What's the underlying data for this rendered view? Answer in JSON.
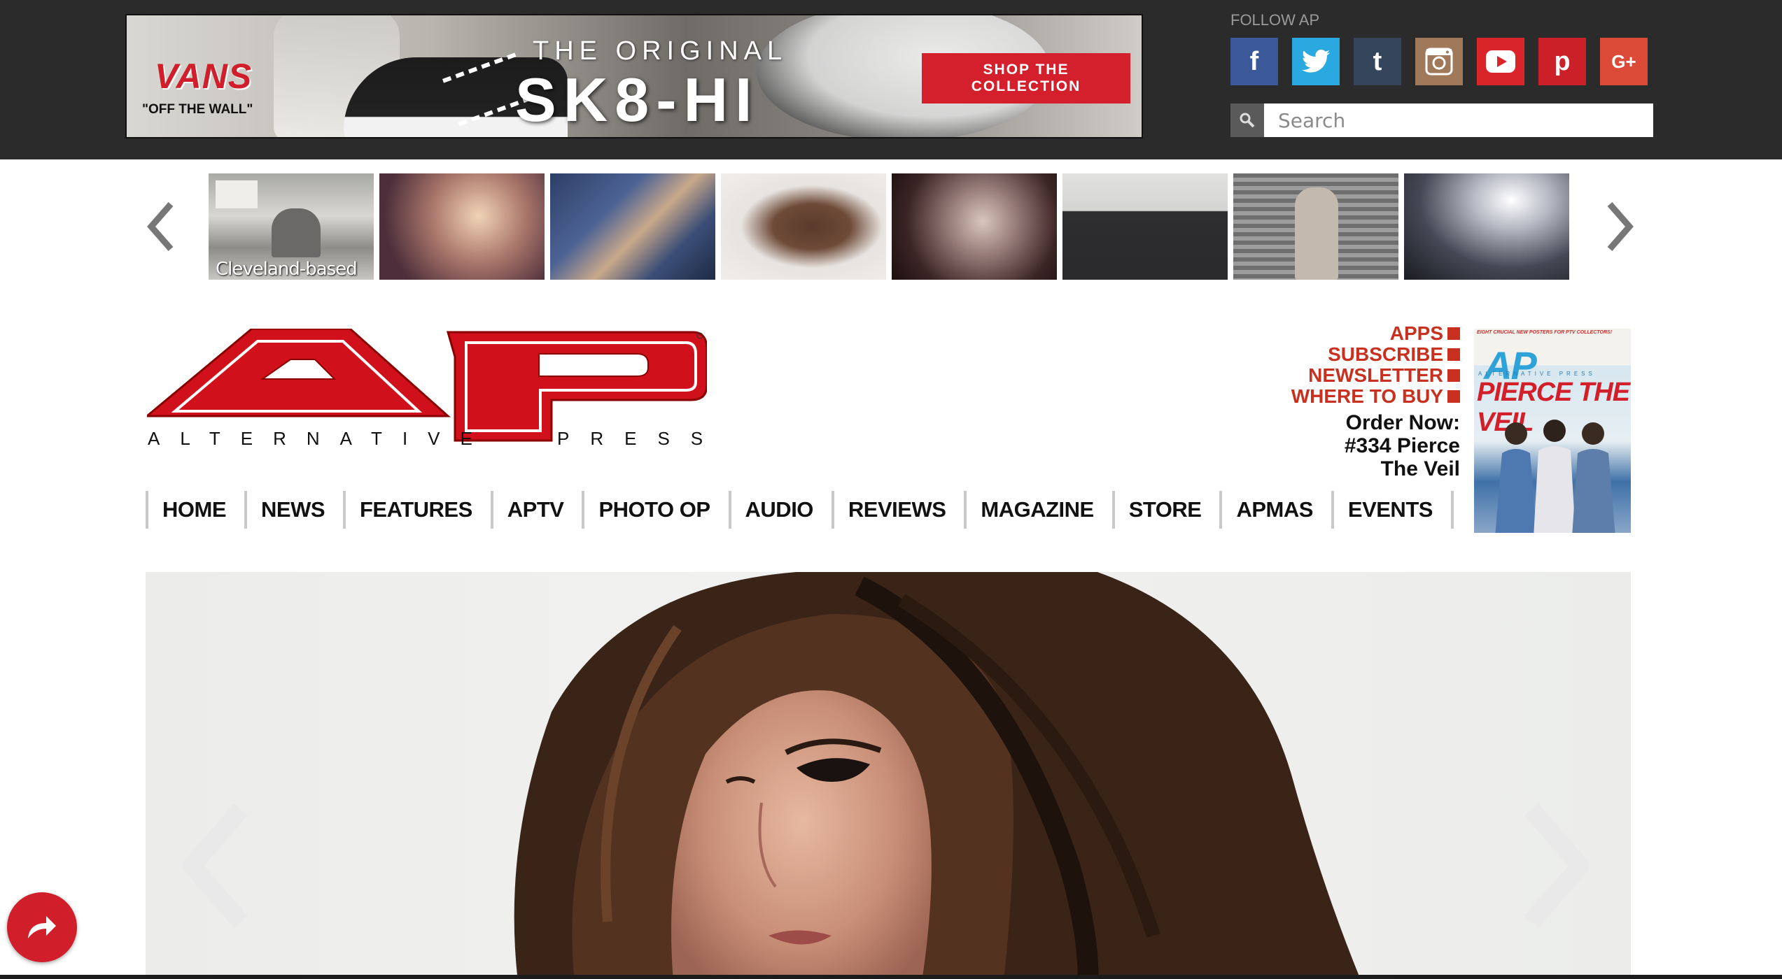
{
  "ad": {
    "brand": "VANS",
    "tagline": "\"OFF THE WALL\"",
    "headline_small": "THE ORIGINAL",
    "headline_big": "SK8-HI",
    "cta": "SHOP THE COLLECTION"
  },
  "follow": {
    "label": "FOLLOW AP",
    "networks": [
      {
        "name": "facebook",
        "glyph": "f",
        "color": "#3b5998"
      },
      {
        "name": "twitter",
        "glyph": "t",
        "color": "#2aa9e0"
      },
      {
        "name": "tumblr",
        "glyph": "t",
        "color": "#35465c"
      },
      {
        "name": "instagram",
        "glyph": "◙",
        "color": "#a0785a"
      },
      {
        "name": "youtube",
        "glyph": "▶",
        "color": "#d9252a"
      },
      {
        "name": "pinterest",
        "glyph": "p",
        "color": "#cb2027"
      },
      {
        "name": "google-plus",
        "glyph": "G+",
        "color": "#dc4a38"
      }
    ]
  },
  "search": {
    "placeholder": "Search"
  },
  "carousel": {
    "first_caption": "Cleveland-based"
  },
  "logo": {
    "left_word": "ALTERNATIVE",
    "right_word": "PRESS",
    "main": "AP"
  },
  "quick_links": [
    "APPS",
    "SUBSCRIBE",
    "NEWSLETTER",
    "WHERE TO BUY"
  ],
  "order": {
    "line1": "Order Now:",
    "line2": "#334 Pierce",
    "line3": "The Veil"
  },
  "magazine": {
    "top_text": "EIGHT CRUCIAL NEW POSTERS FOR PTV COLLECTORS!",
    "logo": "AP",
    "alt": "ALTERNATIVE PRESS",
    "title": "PIERCE THE VEIL"
  },
  "nav": [
    "HOME",
    "NEWS",
    "FEATURES",
    "APTV",
    "PHOTO OP",
    "AUDIO",
    "REVIEWS",
    "MAGAZINE",
    "STORE",
    "APMAS",
    "EVENTS"
  ],
  "colors": {
    "brand_red": "#d0111b",
    "topbar": "#2b2b2b",
    "link_red": "#c8311f"
  }
}
